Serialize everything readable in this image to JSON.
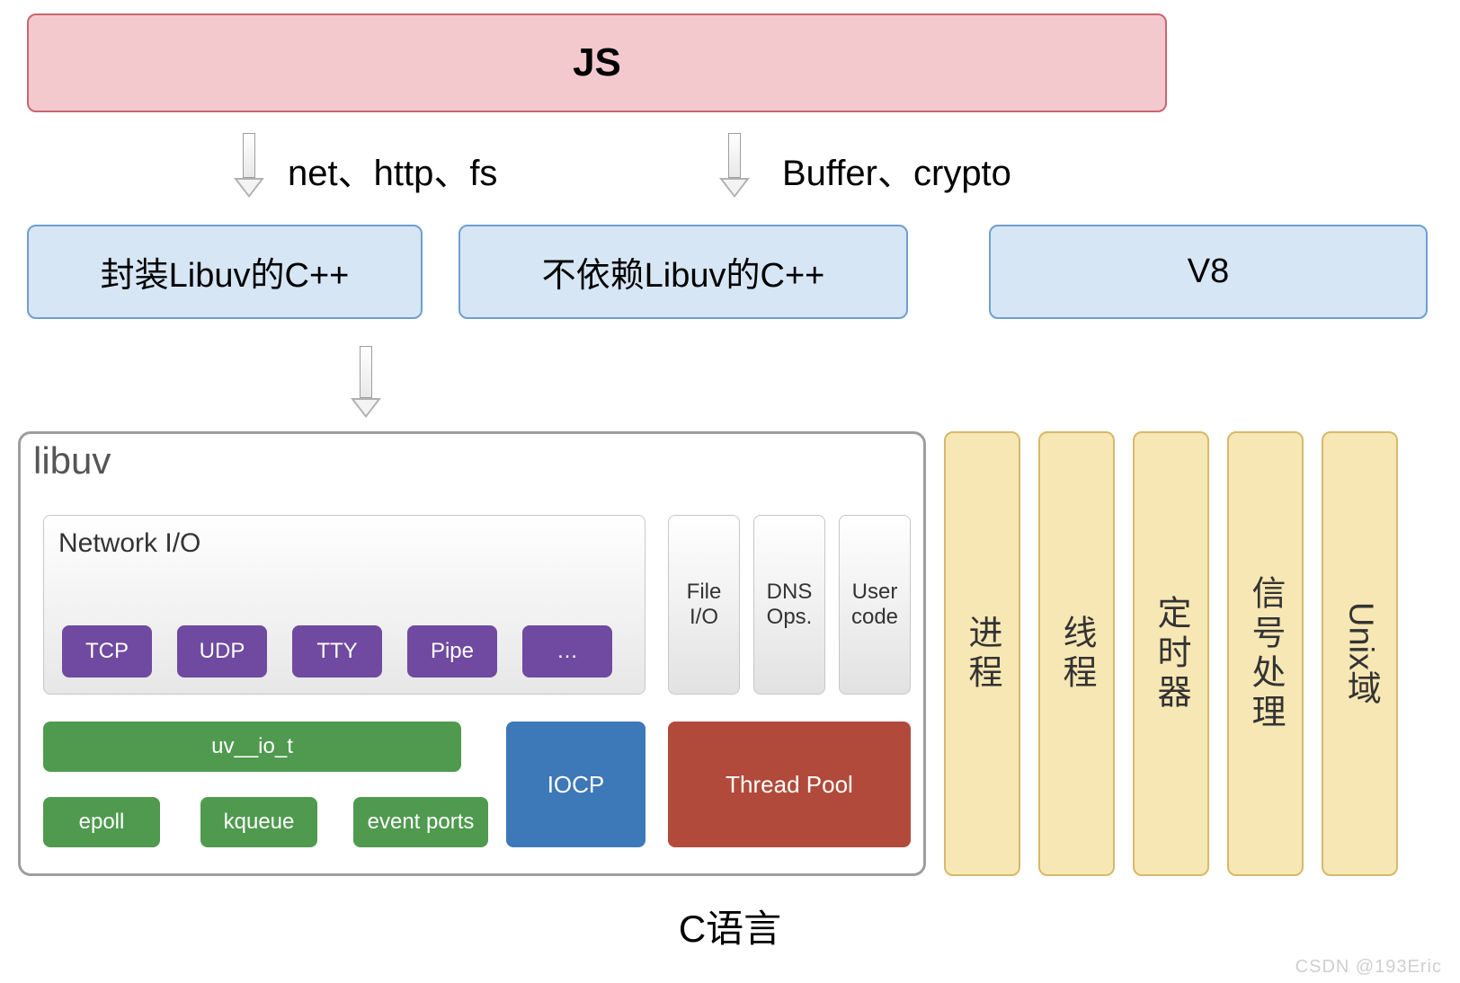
{
  "top": {
    "js": "JS"
  },
  "edges": {
    "left": "net、http、fs",
    "right": "Buffer、crypto"
  },
  "layer2": {
    "wrap_libuv": "封装Libuv的C++",
    "no_libuv": "不依赖Libuv的C++",
    "v8": "V8"
  },
  "libuv": {
    "title": "libuv",
    "network_io_label": "Network I/O",
    "protocols": [
      "TCP",
      "UDP",
      "TTY",
      "Pipe",
      "…"
    ],
    "file_io": "File\nI/O",
    "dns": "DNS\nOps.",
    "user_code": "User\ncode",
    "uv_io_t": "uv__io_t",
    "iocp": "IOCP",
    "thread_pool": "Thread Pool",
    "epoll": "epoll",
    "kqueue": "kqueue",
    "event_ports": "event ports"
  },
  "os_columns": [
    "进程",
    "线程",
    "定时器",
    "信号处理",
    "Unix域"
  ],
  "bottom": "C语言",
  "watermark": "CSDN @193Eric"
}
